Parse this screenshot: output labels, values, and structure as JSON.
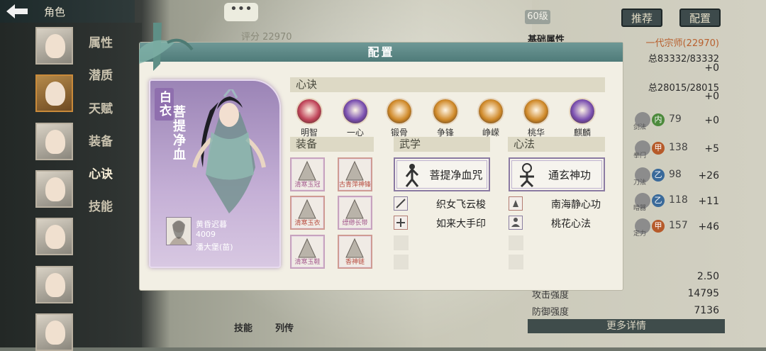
{
  "nav": {
    "title": "角色",
    "items": [
      "属性",
      "潜质",
      "天赋",
      "装备",
      "心诀",
      "技能"
    ]
  },
  "background": {
    "level": "60级",
    "recommend_btn": "推荐",
    "config_btn": "配置",
    "score_label": "评分",
    "score": "22970",
    "basic_attr": "基础属性",
    "rank": "一代宗师(22970)",
    "hp": "总83332/83332",
    "hp_plus": "+0",
    "mp": "总28015/28015",
    "mp_plus": "+0",
    "stats": [
      {
        "name": "剑法",
        "badge": "内",
        "value": "79",
        "plus": "+0",
        "color": "#4c8a3c"
      },
      {
        "name": "拳门",
        "badge": "甲",
        "value": "138",
        "plus": "+5",
        "color": "#b65a2a"
      },
      {
        "name": "刀法",
        "badge": "乙",
        "value": "98",
        "plus": "+26",
        "color": "#3a6a9a"
      },
      {
        "name": "暗器",
        "badge": "乙",
        "value": "118",
        "plus": "+11",
        "color": "#3a6a9a"
      },
      {
        "name": "定力",
        "badge": "甲",
        "value": "157",
        "plus": "+46",
        "color": "#b65a2a"
      }
    ],
    "crit_val": "2.50",
    "attack_label": "攻击强度",
    "attack_val": "14795",
    "defense_label": "防御强度",
    "defense_val": "7136",
    "more": "更多详情",
    "bottom_tabs": [
      "技能",
      "列传"
    ],
    "bubble": "•••"
  },
  "dialog": {
    "title": "配置",
    "card": {
      "side_label": "白衣",
      "name": "菩提净血",
      "owner_name": "黄昏迟暮",
      "owner_id": "4009",
      "owner_group": "潘大堡(苗)"
    },
    "xinjue": {
      "header": "心诀",
      "items": [
        {
          "label": "明智",
          "color": "#c0455a"
        },
        {
          "label": "一心",
          "color": "#7a4fb0"
        },
        {
          "label": "锻骨",
          "color": "#d08a2a"
        },
        {
          "label": "争锋",
          "color": "#d08a2a"
        },
        {
          "label": "峥嵘",
          "color": "#d08a2a"
        },
        {
          "label": "桃华",
          "color": "#d08a2a"
        },
        {
          "label": "麒麟",
          "color": "#7a4fb0"
        }
      ]
    },
    "equip": {
      "header": "装备",
      "items": [
        "清寒玉冠",
        "古青萍神锋",
        "清寒玉衣",
        "缥缈长带",
        "清寒玉鞋",
        "香神链"
      ]
    },
    "wuxue": {
      "header": "武学",
      "main": "菩提净血咒",
      "subs": [
        "织女飞云梭",
        "如来大手印"
      ]
    },
    "xinfa": {
      "header": "心法",
      "main": "通玄神功",
      "subs": [
        "南海静心功",
        "桃花心法"
      ]
    }
  }
}
